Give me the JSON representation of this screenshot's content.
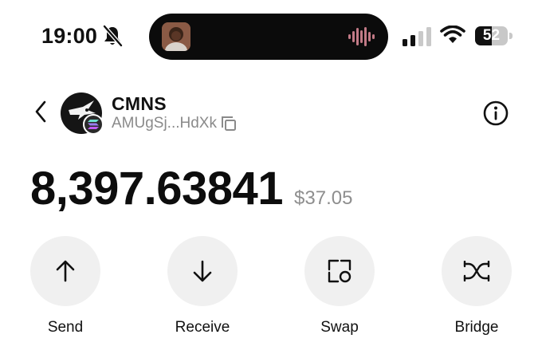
{
  "status_bar": {
    "time": "19:00",
    "battery": "52",
    "battery_level": 0.52,
    "icons": [
      "bell-slash-icon",
      "waveform-icon",
      "cellular-signal-icon",
      "wifi-icon",
      "battery-icon"
    ]
  },
  "header": {
    "back_icon": "chevron-left-icon",
    "token_name": "CMNS",
    "token_address": "AMUgSj...HdXk",
    "copy_icon": "copy-icon",
    "info_icon": "info-icon"
  },
  "balance": {
    "amount": "8,397.63841",
    "fiat": "$37.05"
  },
  "actions": [
    {
      "label": "Send",
      "icon": "arrow-up-icon"
    },
    {
      "label": "Receive",
      "icon": "arrow-down-icon"
    },
    {
      "label": "Swap",
      "icon": "swap-icon"
    },
    {
      "label": "Bridge",
      "icon": "bridge-icon"
    }
  ],
  "colors": {
    "background": "#ffffff",
    "text": "#111111",
    "muted": "#8a8a8a",
    "action_bg": "#f0f0f0",
    "island": "#0b0b0b"
  }
}
